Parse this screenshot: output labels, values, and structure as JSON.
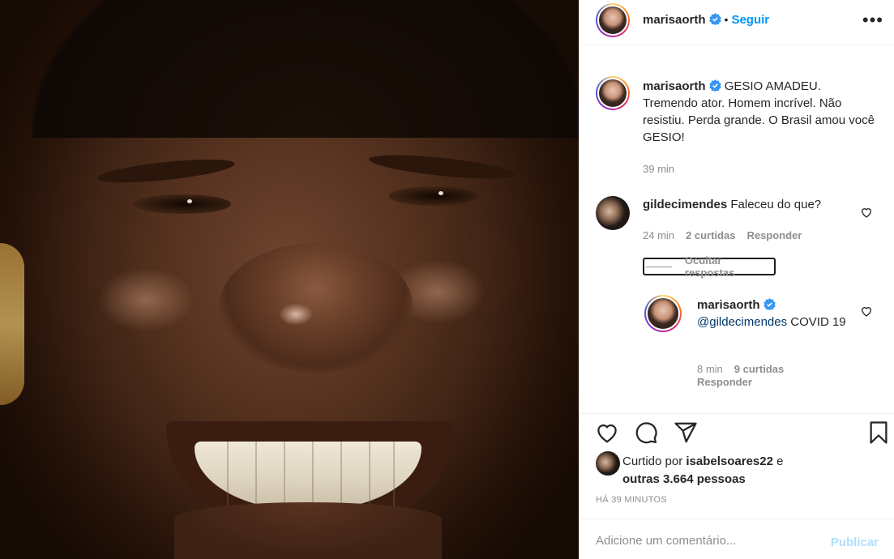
{
  "post": {
    "author": "marisaorth",
    "follow_label": "Seguir",
    "dot": "•",
    "more_label": "•••"
  },
  "caption": {
    "author": "marisaorth",
    "text": "GESIO AMADEU. Tremendo ator. Homem incrível. Não resistiu. Perda grande. O Brasil amou você GESIO!",
    "time": "39 min"
  },
  "comments": [
    {
      "author": "gildecimendes",
      "text": "Faleceu do que?",
      "time": "24 min",
      "likes": "2 curtidas",
      "reply_label": "Responder",
      "hide_replies_label": "Ocultar respostas"
    }
  ],
  "reply": {
    "author": "marisaorth",
    "mention": "@gildecimendes",
    "text": " COVID 19",
    "time": "8 min",
    "likes": "9 curtidas",
    "reply_label": "Responder"
  },
  "likes": {
    "prefix": "Curtido por",
    "user": "isabelsoares22",
    "suffix": "e",
    "others": "outras 3.664 pessoas"
  },
  "timestamp": "HÁ 39 MINUTOS",
  "add_comment": {
    "placeholder": "Adicione um comentário...",
    "publish_label": "Publicar"
  },
  "colors": {
    "accent": "#0095f6",
    "publish_disabled": "#b2dffc",
    "muted": "#8e8e8e",
    "text": "#262626"
  },
  "icons": [
    "verified-badge-icon",
    "more-options-icon",
    "heart-icon",
    "comment-icon",
    "share-icon",
    "bookmark-icon"
  ]
}
